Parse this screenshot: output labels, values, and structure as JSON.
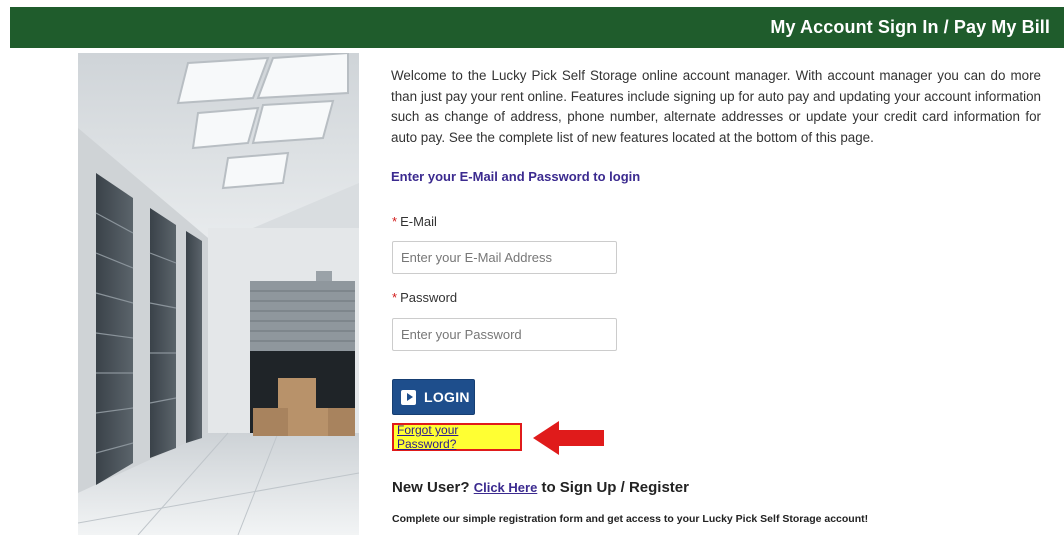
{
  "header": {
    "title": "My Account Sign In / Pay My Bill",
    "background_color": "#1f5c2c"
  },
  "intro": {
    "text": "Welcome to the Lucky Pick Self Storage online account manager. With account manager you can do more than just pay your rent online. Features include signing up for auto pay and updating your account information such as change of address, phone number, alternate addresses or update your credit card information for auto pay. See the complete list of new features located at the bottom of this page."
  },
  "login": {
    "heading": "Enter your E-Mail and Password to login",
    "email_label": "E-Mail",
    "email_placeholder": "Enter your E-Mail Address",
    "email_value": "",
    "password_label": "Password",
    "password_placeholder": "Enter your Password",
    "password_value": "",
    "required_marker": "*",
    "button_label": "LOGIN",
    "forgot_link": "Forgot your Password?"
  },
  "register": {
    "prefix": "New User?",
    "link": "Click Here",
    "suffix": "to Sign Up / Register",
    "note": "Complete our simple registration form and get access to your Lucky Pick Self Storage account!"
  },
  "icons": {
    "login_button_icon": "play-icon",
    "annotation": "red-arrow-icon"
  },
  "colors": {
    "button": "#1e4e8c",
    "heading_text": "#3b2a8f",
    "highlight": "#ffff33",
    "highlight_border": "#e01b1b"
  }
}
